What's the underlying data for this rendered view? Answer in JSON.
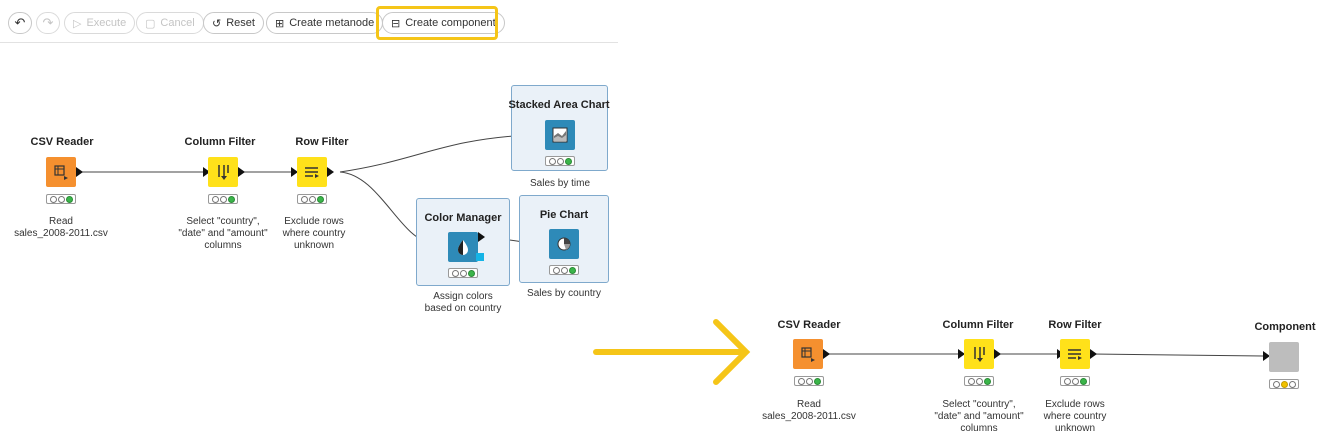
{
  "toolbar": {
    "undo_icon": "undo-icon",
    "redo_icon": "redo-icon",
    "execute_label": "Execute",
    "cancel_label": "Cancel",
    "reset_label": "Reset",
    "create_metanode_label": "Create metanode",
    "create_component_label": "Create component"
  },
  "before": {
    "nodes": {
      "csv_reader": {
        "title": "CSV Reader",
        "desc": "Read\nsales_2008-2011.csv"
      },
      "column_filter": {
        "title": "Column Filter",
        "desc": "Select \"country\",\n\"date\" and \"amount\"\ncolumns"
      },
      "row_filter": {
        "title": "Row Filter",
        "desc": "Exclude rows\nwhere country\nunknown"
      },
      "stacked_area": {
        "title": "Stacked Area Chart",
        "desc": "Sales by time"
      },
      "color_manager": {
        "title": "Color Manager",
        "desc": "Assign colors\nbased on country"
      },
      "pie_chart": {
        "title": "Pie Chart",
        "desc": "Sales by country"
      }
    }
  },
  "after": {
    "nodes": {
      "csv_reader": {
        "title": "CSV Reader",
        "desc": "Read\nsales_2008-2011.csv"
      },
      "column_filter": {
        "title": "Column Filter",
        "desc": "Select \"country\",\n\"date\" and \"amount\"\ncolumns"
      },
      "row_filter": {
        "title": "Row Filter",
        "desc": "Exclude rows\nwhere country\nunknown"
      },
      "component": {
        "title": "Component"
      }
    }
  },
  "colors": {
    "highlight": "#f5c518",
    "reader_node": "#f5902f",
    "manipulator_node": "#ffe11a",
    "view_node": "#2e8ab8",
    "component_node": "#bdbdbd",
    "status_green": "#3bb54a",
    "status_yellow": "#f2c200"
  }
}
